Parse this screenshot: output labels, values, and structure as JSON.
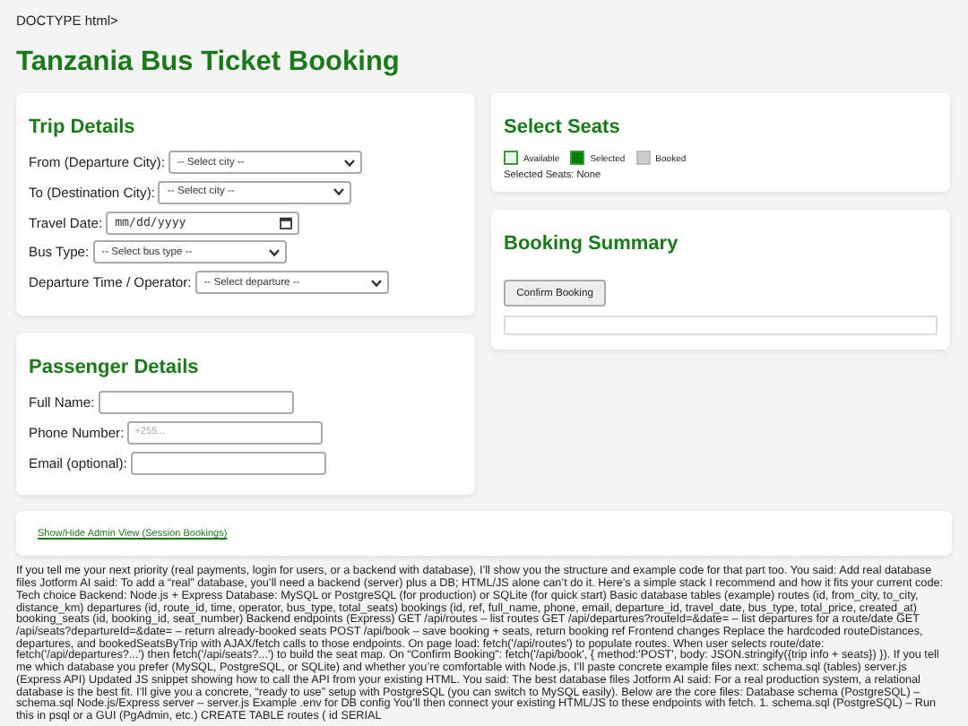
{
  "doctype_text": "DOCTYPE html>",
  "title": "Tanzania Bus Ticket Booking",
  "trip_details": {
    "heading": "Trip Details",
    "fields": [
      {
        "label": "From (Departure City):",
        "kind": "select",
        "value": "-- Select city --"
      },
      {
        "label": "To (Destination City):",
        "kind": "select",
        "value": "-- Select city --"
      },
      {
        "label": "Travel Date:",
        "kind": "date",
        "value": "mm/dd/yyyy"
      },
      {
        "label": "Bus Type:",
        "kind": "select",
        "value": "-- Select bus type --"
      },
      {
        "label": "Departure Time / Operator:",
        "kind": "select",
        "value": "-- Select departure --"
      }
    ]
  },
  "passenger_details": {
    "heading": "Passenger Details",
    "fields": [
      {
        "label": "Full Name:"
      },
      {
        "label": "Phone Number:",
        "placeholder": "+255..."
      },
      {
        "label": "Email (optional):"
      }
    ]
  },
  "select_seats": {
    "heading": "Select Seats",
    "legend": [
      {
        "label": "Available",
        "color": "#e8f8e8"
      },
      {
        "label": "Selected",
        "color": "#008000"
      },
      {
        "label": "Booked",
        "color": "#cccccc"
      }
    ],
    "selected_seats_text": "Selected Seats: None"
  },
  "booking_summary": {
    "heading": "Booking Summary",
    "button": "Confirm Booking"
  },
  "admin_link": "Show/Hide Admin View (Session Bookings)",
  "body_text": "If you tell me your next priority (real payments, login for users, or a backend with database), I’ll show you the structure and example code for that part too. You said: Add real database files Jotform AI said: To add a “real” database, you’ll need a backend (server) plus a DB; HTML/JS alone can’t do it. Here’s a simple stack I recommend and how it fits your current code: Tech choice Backend: Node.js + Express Database: MySQL or PostgreSQL (for production) or SQLite (for quick start) Basic database tables (example) routes (id, from_city, to_city, distance_km) departures (id, route_id, time, operator, bus_type, total_seats) bookings (id, ref, full_name, phone, email, departure_id, travel_date, bus_type, total_price, created_at) booking_seats (id, booking_id, seat_number) Backend endpoints (Express) GET /api/routes – list routes GET /api/departures?routeId=&date= – list departures for a route/date GET /api/seats?departureId=&date= – return already-booked seats POST /api/book – save booking + seats, return booking ref Frontend changes Replace the hardcoded routeDistances, departures, and bookedSeatsByTrip with AJAX/fetch calls to those endpoints. On page load: fetch('/api/routes') to populate routes. When user selects route/date: fetch('/api/departures?...') then fetch('/api/seats?...') to build the seat map. On “Confirm Booking”: fetch('/api/book', { method:'POST', body: JSON.stringify({trip info + seats}) }). If you tell me which database you prefer (MySQL, PostgreSQL, or SQLite) and whether you’re comfortable with Node.js, I’ll paste concrete example files next: schema.sql (tables) server.js (Express API) Updated JS snippet showing how to call the API from your existing HTML. You said: The best database files Jotform AI said: For a real production system, a relational database is the best fit. I’ll give you a concrete, “ready to use” setup with PostgreSQL (you can switch to MySQL easily). Below are the core files: Database schema (PostgreSQL) – schema.sql Node.js/Express server – server.js Example .env for DB config You’ll then connect your existing HTML/JS to these endpoints with fetch. 1. schema.sql (PostgreSQL) – Run this in psql or a GUI (PgAdmin, etc.) CREATE TABLE routes ( id SERIAL"
}
